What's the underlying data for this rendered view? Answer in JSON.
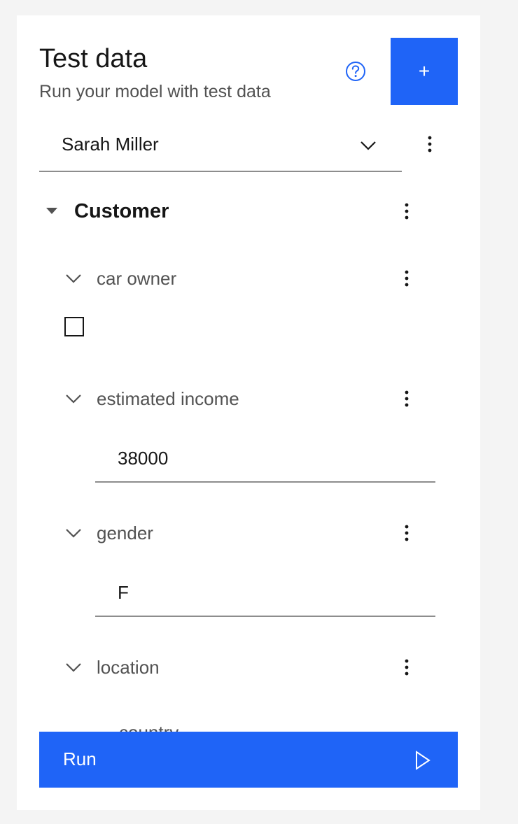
{
  "panel": {
    "title": "Test data",
    "subtitle": "Run your model with test data",
    "help_icon": "help-circle-icon",
    "add_button_label": "+"
  },
  "selector": {
    "value": "Sarah Miller"
  },
  "section": {
    "title": "Customer",
    "fields": [
      {
        "label": "car owner",
        "type": "checkbox",
        "checked": false
      },
      {
        "label": "estimated income",
        "type": "text",
        "value": "38000"
      },
      {
        "label": "gender",
        "type": "text",
        "value": "F"
      },
      {
        "label": "location",
        "type": "group",
        "child_label": "country"
      }
    ]
  },
  "run_button": {
    "label": "Run",
    "icon": "play-icon"
  },
  "colors": {
    "primary": "#1f64f7",
    "background": "#f4f4f4",
    "panel": "#ffffff",
    "text": "#161616",
    "secondary_text": "#525252",
    "border": "#8d8d8d"
  }
}
